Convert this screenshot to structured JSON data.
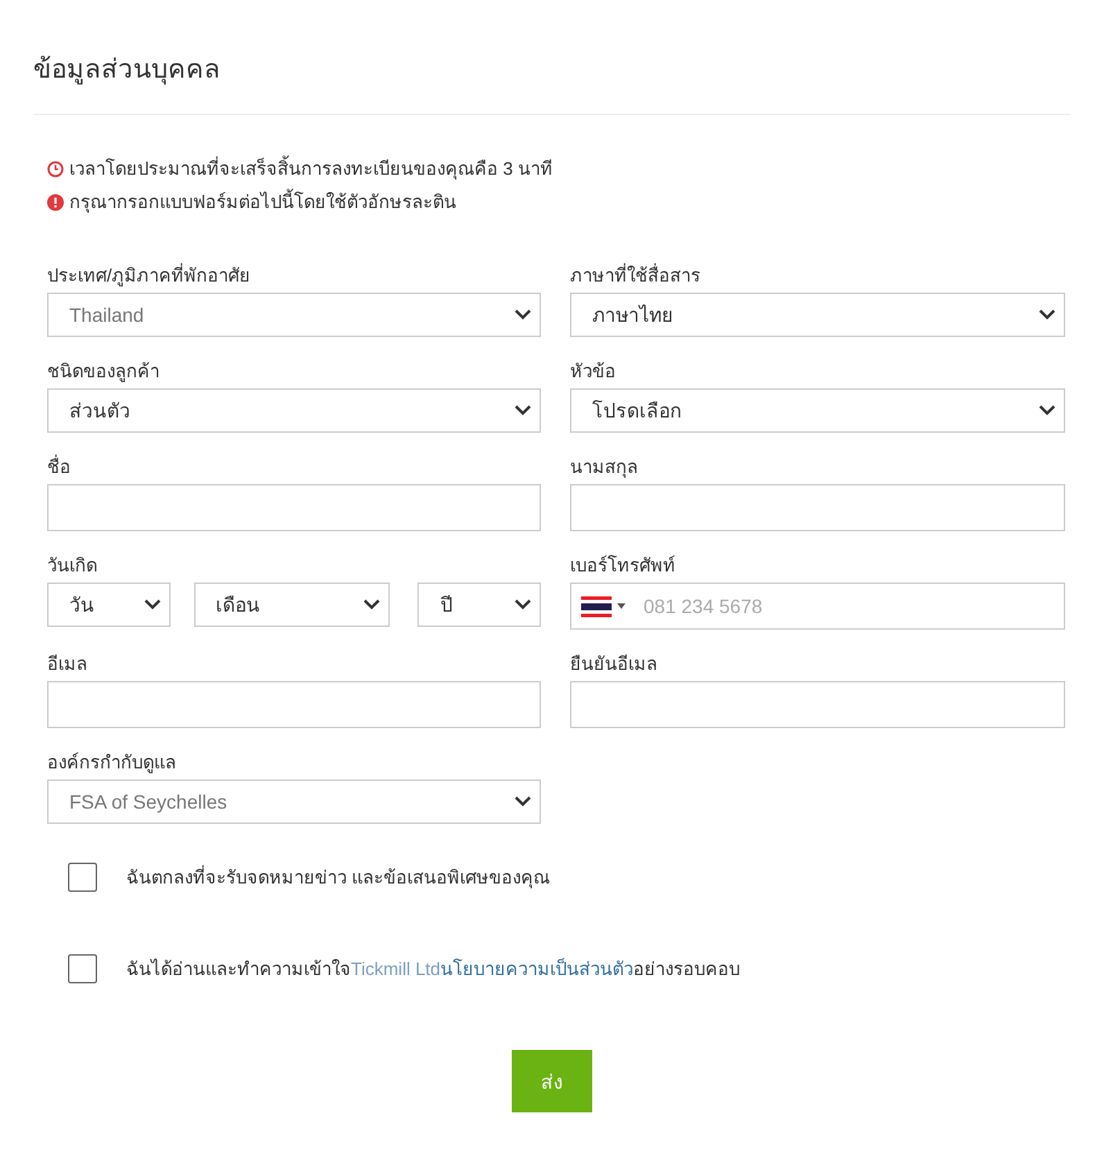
{
  "title": "ข้อมูลส่วนบุคคล",
  "notices": [
    {
      "kind": "time",
      "text": "เวลาโดยประมาณที่จะเสร็จสิ้นการลงทะเบียนของคุณคือ 3 นาที"
    },
    {
      "kind": "alert",
      "text": "กรุณากรอกแบบฟอร์มต่อไปนี้โดยใช้ตัวอักษรละติน"
    }
  ],
  "fields": [
    {
      "kind": "select",
      "label": "ประเทศ/ภูมิภาคที่พักอาศัย",
      "value": "Thailand",
      "muted": true
    },
    {
      "kind": "select",
      "label": "ภาษาที่ใช้สื่อสาร",
      "value": "ภาษาไทย",
      "muted": false
    },
    {
      "kind": "select",
      "label": "ชนิดของลูกค้า",
      "value": "ส่วนตัว",
      "muted": false
    },
    {
      "kind": "select",
      "label": "หัวข้อ",
      "value": "โปรดเลือก",
      "muted": false
    },
    {
      "kind": "input",
      "label": "ชื่อ"
    },
    {
      "kind": "input",
      "label": "นามสกุล"
    },
    {
      "kind": "date",
      "label": "วันเกิด",
      "parts": [
        "วัน",
        "เดือน",
        "ปี"
      ]
    },
    {
      "kind": "phone",
      "label": "เบอร์โทรศัพท์",
      "placeholder": "081 234 5678"
    },
    {
      "kind": "input",
      "label": "อีเมล"
    },
    {
      "kind": "input",
      "label": "ยืนยันอีเมล"
    },
    {
      "kind": "select",
      "label": "องค์กรกำกับดูแล",
      "value": "FSA of Seychelles",
      "muted": true
    }
  ],
  "consents": [
    {
      "checked": false,
      "parts": [
        {
          "kind": "text",
          "text": "ฉันตกลงที่จะรับจดหมายข่าว และข้อเสนอพิเศษของคุณ"
        }
      ]
    },
    {
      "checked": false,
      "parts": [
        {
          "kind": "text",
          "text": "ฉันได้อ่านและทำความเข้าใจ"
        },
        {
          "kind": "company",
          "text": "Tickmill Ltd"
        },
        {
          "kind": "link",
          "text": "นโยบายความเป็นส่วนตัว"
        },
        {
          "kind": "text",
          "text": "อย่างรอบคอบ"
        }
      ]
    }
  ],
  "submit": "ส่ง"
}
